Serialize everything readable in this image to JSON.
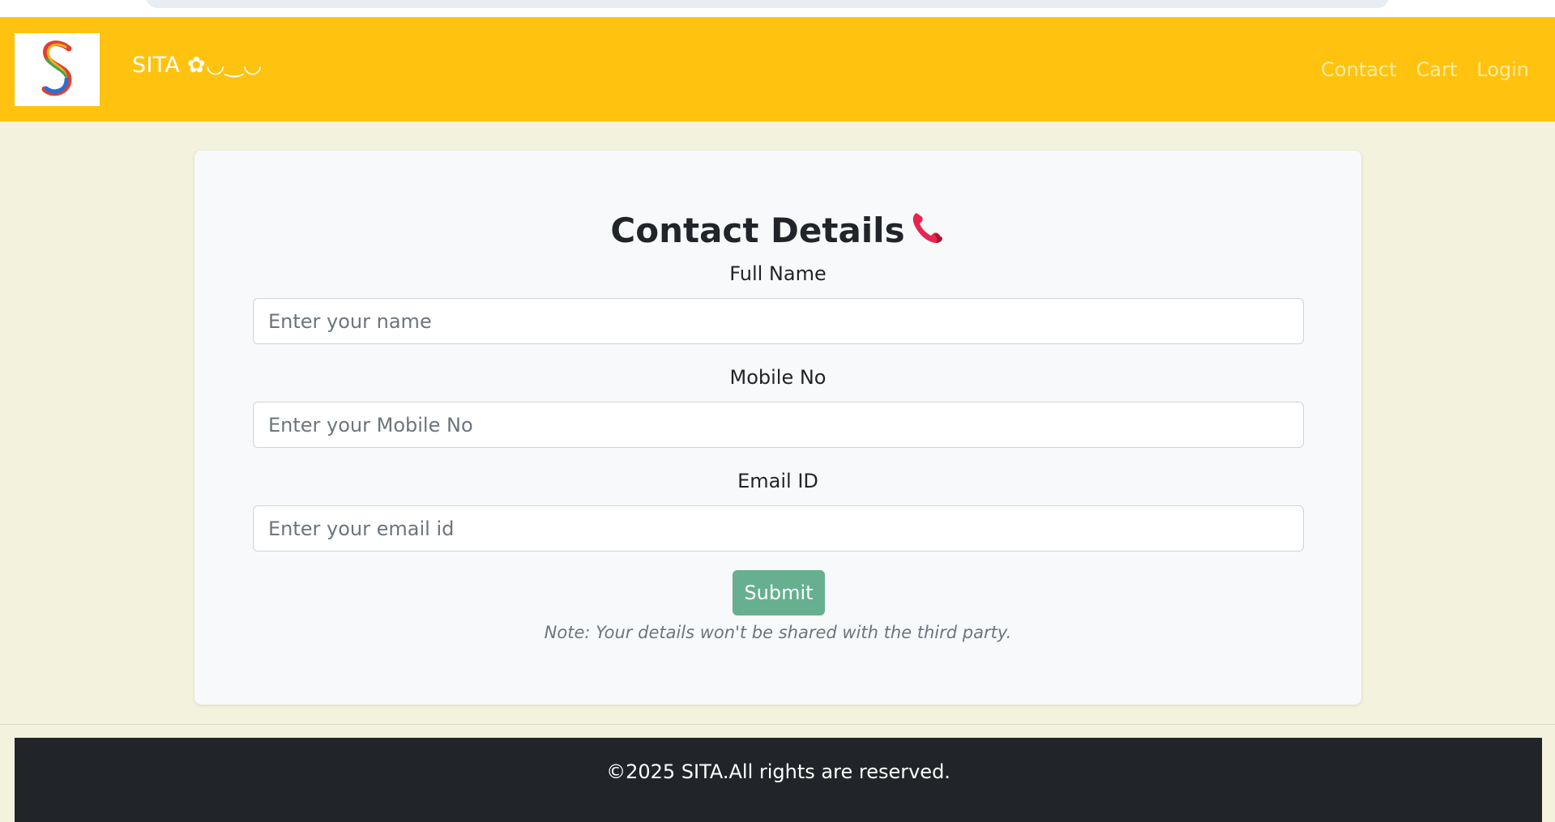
{
  "navbar": {
    "brand": "SITA ✿◡‿◡",
    "links": [
      "Contact",
      "Cart",
      "Login"
    ]
  },
  "form": {
    "title": "Contact Details",
    "fields": [
      {
        "label": "Full Name",
        "placeholder": "Enter your name"
      },
      {
        "label": "Mobile No",
        "placeholder": "Enter your Mobile No"
      },
      {
        "label": "Email ID",
        "placeholder": "Enter your email id"
      }
    ],
    "submit_label": "Submit",
    "note": "Note: Your details won't be shared with the third party."
  },
  "footer": {
    "text": "©2025 SITA.All rights are reserved."
  },
  "colors": {
    "navbar": "#ffc30f",
    "page_bg": "#f3f3dd",
    "card_bg": "#f8f9fa",
    "submit": "#66b08f",
    "footer": "#212529"
  },
  "icons": {
    "logo": "s-logo-icon",
    "title": "telephone-receiver-icon"
  }
}
